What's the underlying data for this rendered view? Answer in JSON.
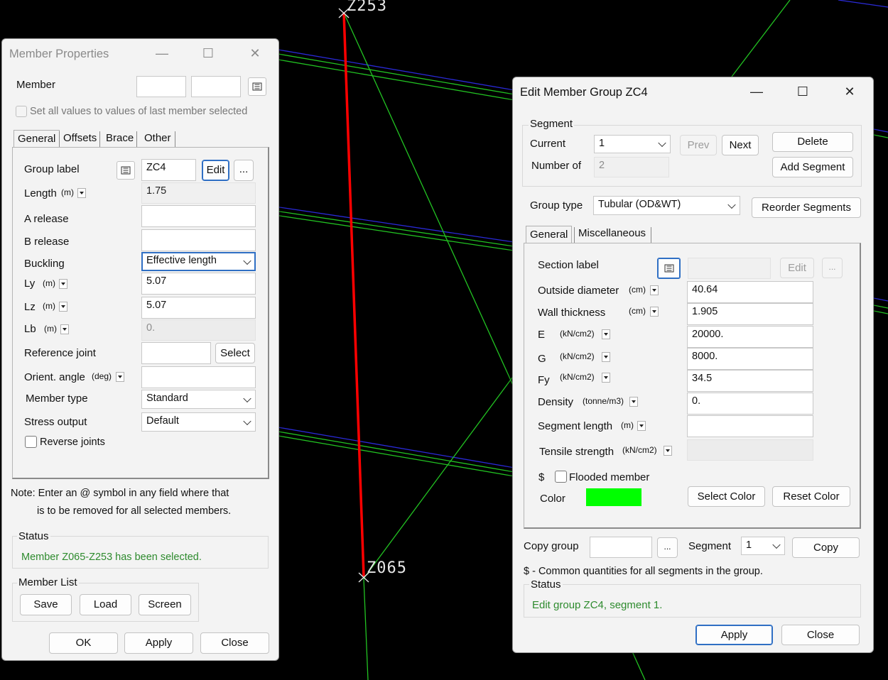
{
  "canvas": {
    "node_top": "Z253",
    "node_bottom": "Z065"
  },
  "member_properties": {
    "title": "Member Properties",
    "member_label": "Member",
    "member_field_1": "",
    "member_field_2": "",
    "set_all_label": "Set all values to values of last member selected",
    "tabs": [
      "General",
      "Offsets",
      "Brace",
      "Other"
    ],
    "group_label": "Group label",
    "group_value": "ZC4",
    "edit_button": "Edit",
    "more_button": "...",
    "length_label": "Length",
    "length_unit": "(m)",
    "length_value": "1.75",
    "a_release_label": "A release",
    "a_release_value": "",
    "b_release_label": "B release",
    "b_release_value": "",
    "buckling_label": "Buckling",
    "buckling_value": "Effective length",
    "ly_label": "Ly",
    "ly_unit": "(m)",
    "ly_value": "5.07",
    "lz_label": "Lz",
    "lz_unit": "(m)",
    "lz_value": "5.07",
    "lb_label": "Lb",
    "lb_unit": "(m)",
    "lb_value": "0.",
    "reference_joint_label": "Reference joint",
    "reference_joint_value": "",
    "select_button": "Select",
    "orient_angle_label": "Orient. angle",
    "orient_angle_unit": "(deg)",
    "orient_angle_value": "",
    "member_type_label": "Member type",
    "member_type_value": "Standard",
    "stress_output_label": "Stress output",
    "stress_output_value": "Default",
    "reverse_joints_label": "Reverse joints",
    "note_line1": "Note: Enter an @ symbol in any field where that",
    "note_line2": "is to be removed for all selected members.",
    "status_label": "Status",
    "status_text": "Member Z065-Z253 has been selected.",
    "member_list_label": "Member List",
    "save_button": "Save",
    "load_button": "Load",
    "screen_button": "Screen",
    "ok_button": "OK",
    "apply_button": "Apply",
    "close_button": "Close"
  },
  "edit_group": {
    "title": "Edit Member Group ZC4",
    "segment_label": "Segment",
    "current_label": "Current",
    "current_value": "1",
    "prev_button": "Prev",
    "next_button": "Next",
    "delete_button": "Delete",
    "number_of_label": "Number of",
    "number_of_value": "2",
    "add_segment_button": "Add Segment",
    "group_type_label": "Group type",
    "group_type_value": "Tubular (OD&WT)",
    "reorder_button": "Reorder Segments",
    "tabs": [
      "General",
      "Miscellaneous"
    ],
    "section_label": "Section label",
    "section_value": "",
    "edit_button": "Edit",
    "more_button": "...",
    "od_label": "Outside diameter",
    "od_unit": "(cm)",
    "od_value": "40.64",
    "wt_label": "Wall thickness",
    "wt_unit": "(cm)",
    "wt_value": "1.905",
    "e_label": "E",
    "e_unit": "(kN/cm2)",
    "e_value": "20000.",
    "g_label": "G",
    "g_unit": "(kN/cm2)",
    "g_value": "8000.",
    "fy_label": "Fy",
    "fy_unit": "(kN/cm2)",
    "fy_value": "34.5",
    "density_label": "Density",
    "density_unit": "(tonne/m3)",
    "density_value": "0.",
    "seglen_label": "Segment length",
    "seglen_unit": "(m)",
    "seglen_value": "",
    "tensile_label": "Tensile strength",
    "tensile_unit": "(kN/cm2)",
    "tensile_value": "",
    "dollar": "$",
    "flooded_label": "Flooded member",
    "color_label": "Color",
    "color_value": "#00ff00",
    "select_color_button": "Select Color",
    "reset_color_button": "Reset Color",
    "copy_group_label": "Copy group",
    "copy_group_value": "",
    "copy_more_button": "...",
    "copy_segment_label": "Segment",
    "copy_segment_value": "1",
    "copy_button": "Copy",
    "common_note": "$ - Common quantities for all segments in the group.",
    "status_label": "Status",
    "status_text": "Edit group ZC4, segment 1.",
    "apply_button": "Apply",
    "close_button": "Close"
  },
  "colors": {
    "member_line": "#ff0000",
    "wire_green": "#22c322",
    "wire_blue": "#2a2ad8",
    "status_green": "#2e8b2e",
    "accent_blue": "#2f6fc4"
  },
  "icons": {
    "list": "list-icon",
    "minimize": "minimize-icon",
    "maximize": "maximize-icon",
    "close": "close-icon",
    "dropdown": "chevron-down-icon"
  }
}
